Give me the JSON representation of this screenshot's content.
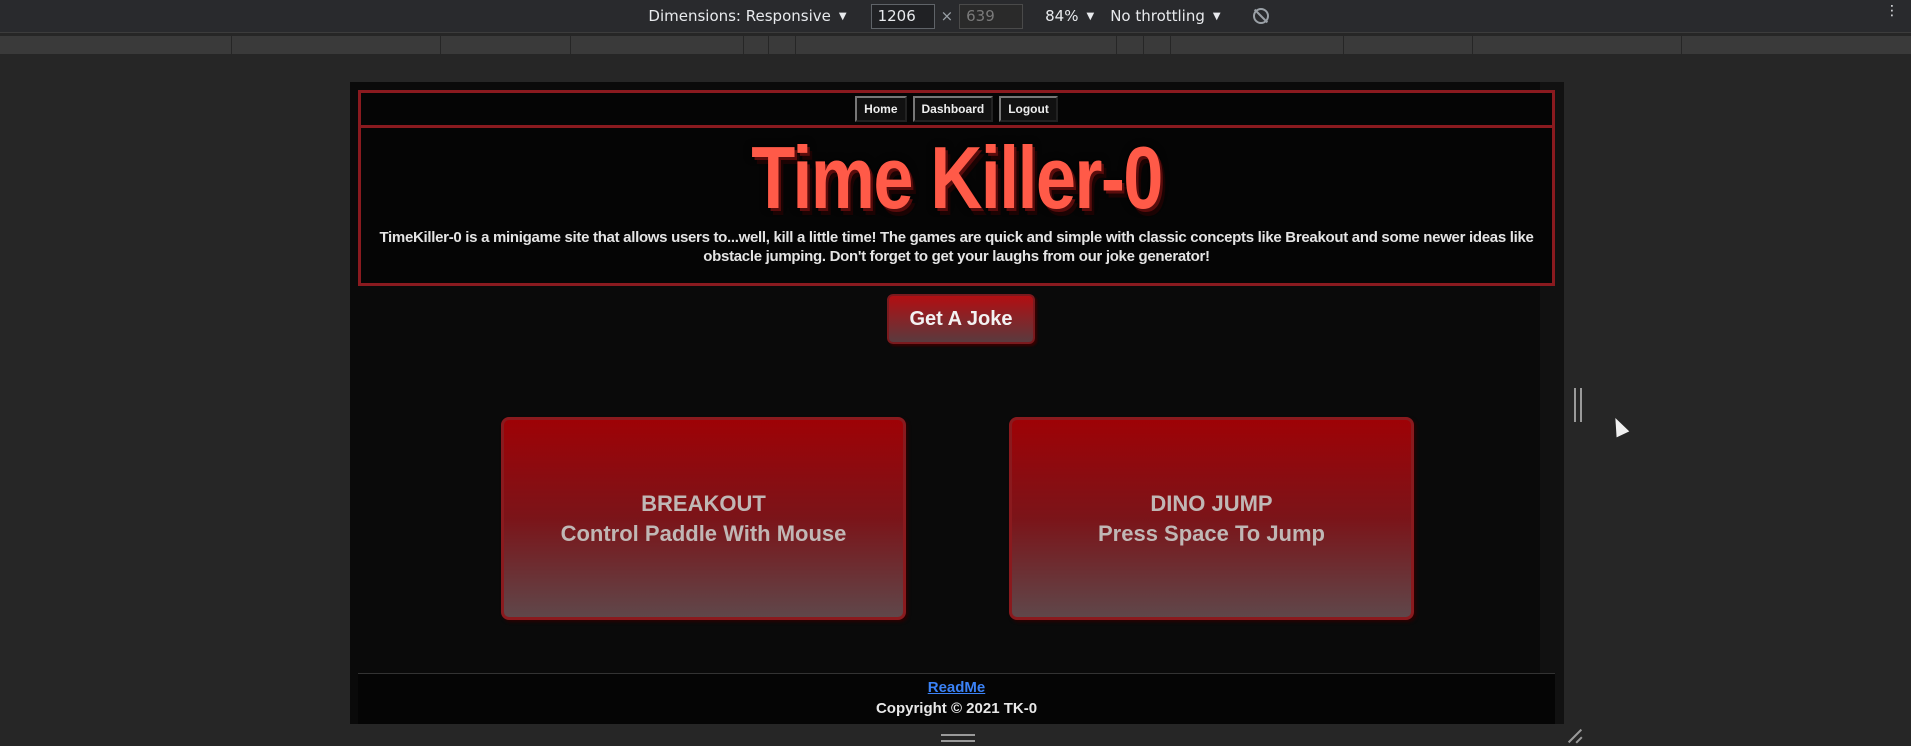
{
  "devtools": {
    "dimensions_label": "Dimensions: Responsive",
    "width_value": "1206",
    "height_value": "639",
    "times_sign": "×",
    "zoom": "84%",
    "throttling": "No throttling",
    "dropdown_caret": "▼",
    "menu_icon": "⋮"
  },
  "site": {
    "nav": [
      "Home",
      "Dashboard",
      "Logout"
    ],
    "title": "Time Killer-0",
    "description": "TimeKiller-0 is a minigame site that allows users to...well, kill a little time! The games are quick and simple with classic concepts like Breakout and some newer ideas like obstacle jumping. Don't forget to get your laughs from our joke generator!",
    "joke_button": "Get A Joke",
    "games": [
      {
        "name": "BREAKOUT",
        "instruction": "Control Paddle With Mouse"
      },
      {
        "name": "DINO JUMP",
        "instruction": "Press Space To Jump"
      }
    ],
    "footer": {
      "readme": "ReadMe",
      "copyright": "Copyright © 2021 TK-0"
    }
  },
  "colors": {
    "accent_red": "#8a1a1f",
    "title_red": "#ff5a48",
    "link_blue": "#3b82f6"
  }
}
